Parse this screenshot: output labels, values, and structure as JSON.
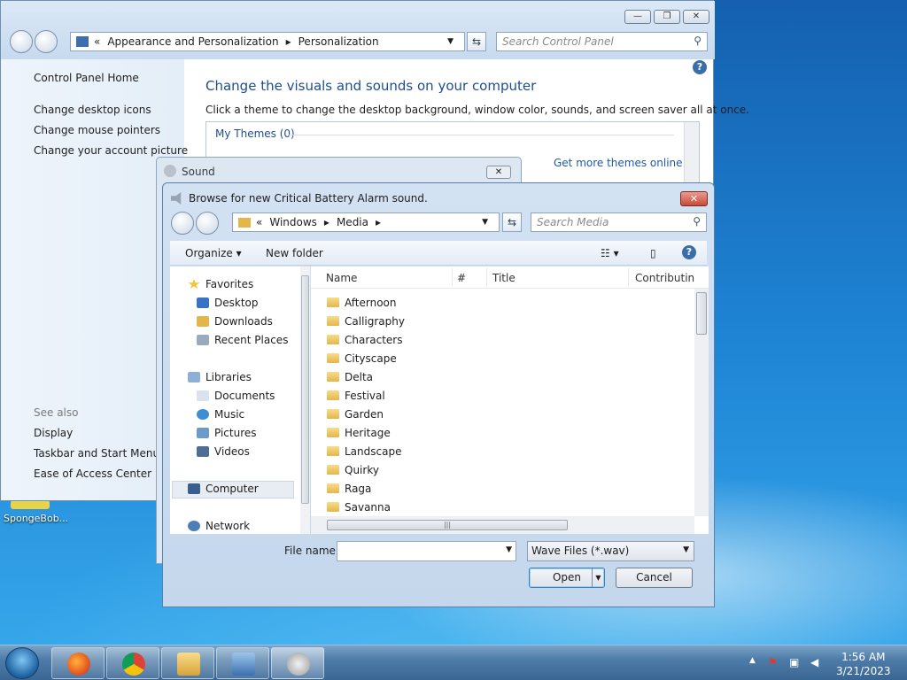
{
  "desktop": {
    "icon_label": "SpongeBob..."
  },
  "control_panel": {
    "breadcrumb": [
      "«",
      "Appearance and Personalization",
      "▸",
      "Personalization"
    ],
    "search_placeholder": "Search Control Panel",
    "window_buttons": [
      "—",
      "❐",
      "✕"
    ],
    "left_links": [
      "Control Panel Home",
      "Change desktop icons",
      "Change mouse pointers",
      "Change your account picture"
    ],
    "see_also_label": "See also",
    "see_also": [
      "Display",
      "Taskbar and Start Menu",
      "Ease of Access Center"
    ],
    "heading": "Change the visuals and sounds on your computer",
    "description": "Click a theme to change the desktop background, window color, sounds, and screen saver all at once.",
    "my_themes": "My Themes (0)",
    "get_more": "Get more themes online",
    "help": "?"
  },
  "sound_dialog": {
    "title": "Sound",
    "close": "✕"
  },
  "browse_dialog": {
    "title": "Browse for new Critical Battery Alarm sound.",
    "close": "✕",
    "breadcrumb": [
      "«",
      "Windows",
      "▸",
      "Media",
      "▸"
    ],
    "search_placeholder": "Search Media",
    "toolbar": {
      "organize": "Organize ▾",
      "new_folder": "New folder",
      "views": "☷ ▾",
      "pane": "▯",
      "help": "?"
    },
    "nav": {
      "favorites": "Favorites",
      "favorite_items": [
        "Desktop",
        "Downloads",
        "Recent Places"
      ],
      "libraries": "Libraries",
      "library_items": [
        "Documents",
        "Music",
        "Pictures",
        "Videos"
      ],
      "computer": "Computer",
      "network": "Network"
    },
    "columns": [
      "Name",
      "#",
      "Title",
      "Contributing"
    ],
    "folders": [
      "Afternoon",
      "Calligraphy",
      "Characters",
      "Cityscape",
      "Delta",
      "Festival",
      "Garden",
      "Heritage",
      "Landscape",
      "Quirky",
      "Raga",
      "Savanna"
    ],
    "file_name_label": "File name:",
    "file_name_value": "",
    "file_type": "Wave Files (*.wav)",
    "open": "Open",
    "cancel": "Cancel"
  },
  "taskbar": {
    "time": "1:56 AM",
    "date": "3/21/2023",
    "apps": [
      "firefox",
      "chrome",
      "file-explorer",
      "control-panel",
      "sound"
    ]
  }
}
